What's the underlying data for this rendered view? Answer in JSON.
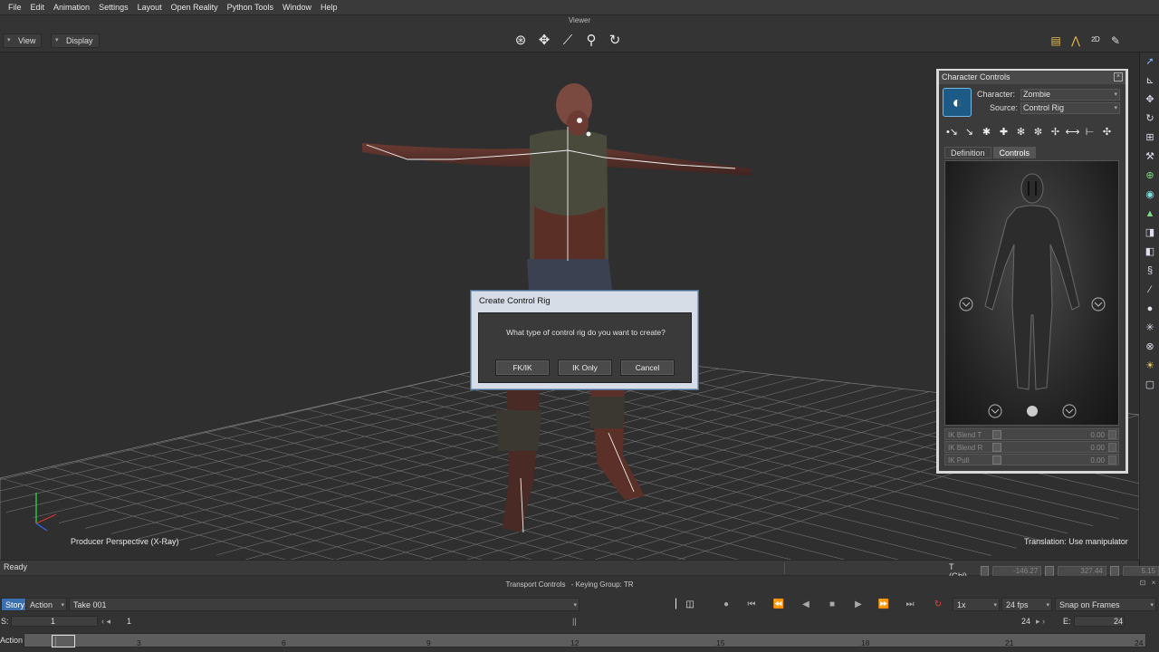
{
  "menu": [
    "File",
    "Edit",
    "Animation",
    "Settings",
    "Layout",
    "Open Reality",
    "Python Tools",
    "Window",
    "Help"
  ],
  "viewer": {
    "title": "Viewer",
    "view_label": "View",
    "display_label": "Display",
    "camera_label": "Producer Perspective (X-Ray)",
    "manip_label": "Translation: Use manipulator"
  },
  "character_controls": {
    "title": "Character Controls",
    "character_label": "Character:",
    "character_value": "Zombie",
    "source_label": "Source:",
    "source_value": "Control Rig",
    "tabs": [
      {
        "label": "Definition",
        "active": false
      },
      {
        "label": "Controls",
        "active": true
      }
    ],
    "sliders": [
      {
        "label": "IK Blend T",
        "value": "0.00"
      },
      {
        "label": "IK Blend R",
        "value": "0.00"
      },
      {
        "label": "IK Pull",
        "value": "0.00"
      }
    ]
  },
  "dialog": {
    "title": "Create Control Rig",
    "message": "What type of control rig do you want to create?",
    "buttons": [
      "FK/IK",
      "IK Only",
      "Cancel"
    ]
  },
  "status": {
    "text": "Ready",
    "coord_label": "T (Gbl)",
    "coords": [
      "-146.27",
      "327.44",
      "5.15"
    ]
  },
  "transport": {
    "title": "Transport Controls",
    "keying_group": "Keying Group: TR",
    "story_label": "Story",
    "action_label": "Action",
    "take": "Take 001",
    "speed": "1x",
    "fps": "24 fps",
    "snap": "Snap on Frames",
    "start_label": "S:",
    "start_value": "1",
    "current_frame": "1",
    "end_frame": "24",
    "end_label": "E:",
    "end_value": "24",
    "track_label": "Action",
    "ticks": [
      "3",
      "6",
      "9",
      "12",
      "15",
      "18",
      "21",
      "24"
    ]
  }
}
